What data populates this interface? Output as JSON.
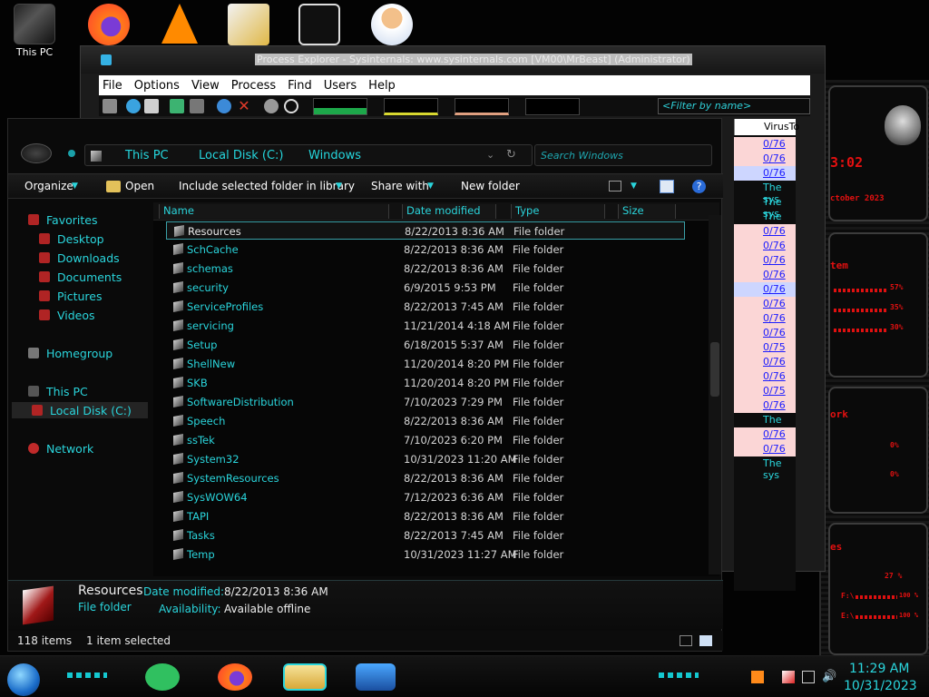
{
  "desktop": {
    "this_pc_label": "This PC"
  },
  "procexp": {
    "title": "Process Explorer - Sysinternals: www.sysinternals.com [VM00\\MrBeast] (Administrator)",
    "menu": [
      "File",
      "Options",
      "View",
      "Process",
      "Find",
      "Users",
      "Help"
    ],
    "filter_placeholder": "<Filter by name>",
    "virustotal_header": "VirusTo",
    "vt_rows": [
      {
        "text": "0/76",
        "style": "pink"
      },
      {
        "text": "0/76",
        "style": "pink"
      },
      {
        "text": "0/76",
        "style": "blue"
      },
      {
        "text": "The sys",
        "style": "txt"
      },
      {
        "text": "The sys",
        "style": "txt"
      },
      {
        "text": "The sys",
        "style": "txt"
      },
      {
        "text": "0/76",
        "style": "pink"
      },
      {
        "text": "0/76",
        "style": "pink"
      },
      {
        "text": "0/76",
        "style": "pink"
      },
      {
        "text": "0/76",
        "style": "pink"
      },
      {
        "text": "0/76",
        "style": "blue"
      },
      {
        "text": "0/76",
        "style": "pink"
      },
      {
        "text": "0/76",
        "style": "pink"
      },
      {
        "text": "0/76",
        "style": "pink"
      },
      {
        "text": "0/75",
        "style": "pink"
      },
      {
        "text": "0/76",
        "style": "pink"
      },
      {
        "text": "0/76",
        "style": "pink"
      },
      {
        "text": "0/75",
        "style": "pink"
      },
      {
        "text": "0/76",
        "style": "pink"
      },
      {
        "text": "The sys",
        "style": "txt"
      },
      {
        "text": "0/76",
        "style": "pink"
      },
      {
        "text": "0/76",
        "style": "pink"
      },
      {
        "text": "The sys",
        "style": "txt"
      }
    ]
  },
  "gadget": {
    "time": "3:02",
    "month": "ctober 2023",
    "system_label": "tem",
    "stat1": "57%",
    "stat2": "35%",
    "stat3": "30%",
    "network_label": "ork",
    "net1": "0%",
    "net2": "0%",
    "tile_label": "es",
    "stat4": "27 %",
    "drive_f": "F:\\",
    "drive_f_pct": "100 %",
    "drive_e": "E:\\",
    "drive_e_pct": "100 %"
  },
  "explorer": {
    "breadcrumb": [
      "This PC",
      "Local Disk (C:)",
      "Windows"
    ],
    "search_placeholder": "Search Windows",
    "commands": {
      "organize": "Organize",
      "open": "Open",
      "include": "Include selected folder in library",
      "share": "Share with",
      "new_folder": "New folder"
    },
    "nav": {
      "favorites": "Favorites",
      "desktop": "Desktop",
      "downloads": "Downloads",
      "documents": "Documents",
      "pictures": "Pictures",
      "videos": "Videos",
      "homegroup": "Homegroup",
      "this_pc": "This PC",
      "local_disk": "Local Disk (C:)",
      "network": "Network"
    },
    "columns": {
      "name": "Name",
      "date": "Date modified",
      "type": "Type",
      "size": "Size"
    },
    "rows": [
      {
        "name": "Resources",
        "date": "8/22/2013 8:36 AM",
        "type": "File folder",
        "selected": true
      },
      {
        "name": "SchCache",
        "date": "8/22/2013 8:36 AM",
        "type": "File folder"
      },
      {
        "name": "schemas",
        "date": "8/22/2013 8:36 AM",
        "type": "File folder"
      },
      {
        "name": "security",
        "date": "6/9/2015 9:53 PM",
        "type": "File folder"
      },
      {
        "name": "ServiceProfiles",
        "date": "8/22/2013 7:45 AM",
        "type": "File folder"
      },
      {
        "name": "servicing",
        "date": "11/21/2014 4:18 AM",
        "type": "File folder"
      },
      {
        "name": "Setup",
        "date": "6/18/2015 5:37 AM",
        "type": "File folder"
      },
      {
        "name": "ShellNew",
        "date": "11/20/2014 8:20 PM",
        "type": "File folder"
      },
      {
        "name": "SKB",
        "date": "11/20/2014 8:20 PM",
        "type": "File folder"
      },
      {
        "name": "SoftwareDistribution",
        "date": "7/10/2023 7:29 PM",
        "type": "File folder"
      },
      {
        "name": "Speech",
        "date": "8/22/2013 8:36 AM",
        "type": "File folder"
      },
      {
        "name": "ssTek",
        "date": "7/10/2023 6:20 PM",
        "type": "File folder"
      },
      {
        "name": "System32",
        "date": "10/31/2023 11:20 AM",
        "type": "File folder"
      },
      {
        "name": "SystemResources",
        "date": "8/22/2013 8:36 AM",
        "type": "File folder"
      },
      {
        "name": "SysWOW64",
        "date": "7/12/2023 6:36 AM",
        "type": "File folder"
      },
      {
        "name": "TAPI",
        "date": "8/22/2013 8:36 AM",
        "type": "File folder"
      },
      {
        "name": "Tasks",
        "date": "8/22/2013 7:45 AM",
        "type": "File folder"
      },
      {
        "name": "Temp",
        "date": "10/31/2023 11:27 AM",
        "type": "File folder"
      }
    ],
    "details": {
      "name": "Resources",
      "kind": "File folder",
      "date_label": "Date modified:",
      "date_value": "8/22/2013 8:36 AM",
      "avail_label": "Availability:",
      "avail_value": "Available offline"
    },
    "status": {
      "items": "118 items",
      "selected": "1 item selected"
    }
  },
  "taskbar": {
    "time": "11:29 AM",
    "date": "10/31/2023"
  },
  "colors": {
    "accent_teal": "#2ad5dc",
    "alert_red": "#e31010",
    "vt_pink": "#fbd6d6",
    "vt_link": "#1c1cff"
  },
  "icons": [
    "folder-icon",
    "windows-start-icon",
    "firefox-icon",
    "vlc-icon",
    "hxd-icon",
    "search-icon",
    "help-icon",
    "speaker-icon",
    "network-icon",
    "flag-icon",
    "shield-icon"
  ]
}
